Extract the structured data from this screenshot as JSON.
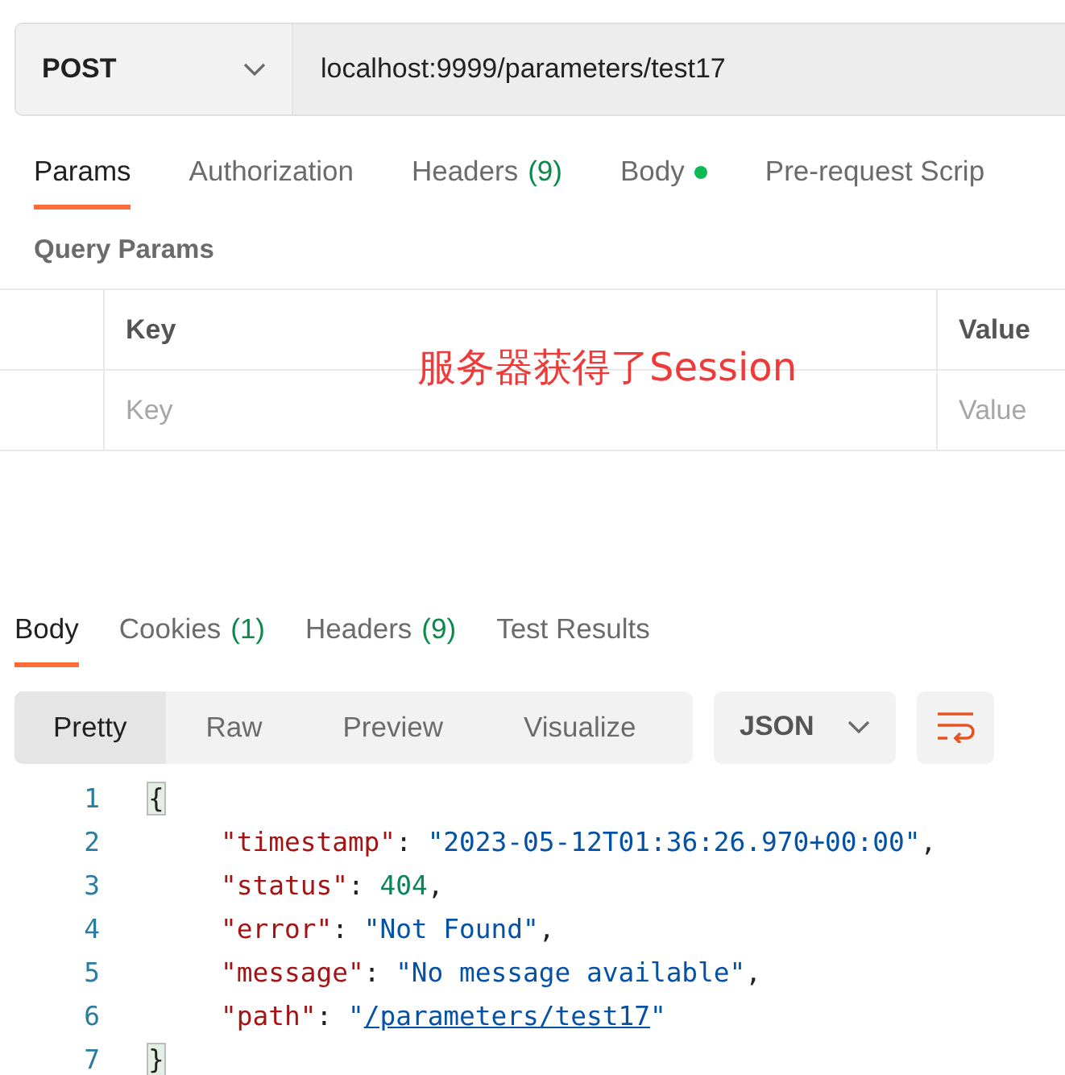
{
  "request": {
    "method": "POST",
    "url": "localhost:9999/parameters/test17"
  },
  "request_tabs": [
    {
      "label": "Params",
      "selected": true
    },
    {
      "label": "Authorization",
      "selected": false
    },
    {
      "label": "Headers",
      "count": "(9)",
      "selected": false
    },
    {
      "label": "Body",
      "dot": true,
      "selected": false
    },
    {
      "label": "Pre-request Scrip",
      "selected": false
    }
  ],
  "query_params": {
    "title": "Query Params",
    "columns": [
      "Key",
      "Value"
    ],
    "placeholders": [
      "Key",
      "Value"
    ]
  },
  "annotation": "服务器获得了Session",
  "response_tabs": [
    {
      "label": "Body",
      "selected": true
    },
    {
      "label": "Cookies",
      "count": "(1)",
      "selected": false
    },
    {
      "label": "Headers",
      "count": "(9)",
      "selected": false
    },
    {
      "label": "Test Results",
      "selected": false
    }
  ],
  "view_modes": [
    {
      "label": "Pretty",
      "selected": true
    },
    {
      "label": "Raw",
      "selected": false
    },
    {
      "label": "Preview",
      "selected": false
    },
    {
      "label": "Visualize",
      "selected": false
    }
  ],
  "format": "JSON",
  "code_lines": [
    {
      "number": "1",
      "tokens": [
        {
          "kind": "brace",
          "text": "{"
        }
      ],
      "children": [
        {
          "number": "2",
          "tokens": [
            {
              "kind": "key",
              "text": "\"timestamp\""
            },
            {
              "kind": "punct",
              "text": ": "
            },
            {
              "kind": "string",
              "text": "\"2023-05-12T01:36:26.970+00:00\""
            },
            {
              "kind": "punct",
              "text": ","
            }
          ]
        },
        {
          "number": "3",
          "tokens": [
            {
              "kind": "key",
              "text": "\"status\""
            },
            {
              "kind": "punct",
              "text": ": "
            },
            {
              "kind": "number",
              "text": "404"
            },
            {
              "kind": "punct",
              "text": ","
            }
          ]
        },
        {
          "number": "4",
          "tokens": [
            {
              "kind": "key",
              "text": "\"error\""
            },
            {
              "kind": "punct",
              "text": ": "
            },
            {
              "kind": "string",
              "text": "\"Not Found\""
            },
            {
              "kind": "punct",
              "text": ","
            }
          ]
        },
        {
          "number": "5",
          "tokens": [
            {
              "kind": "key",
              "text": "\"message\""
            },
            {
              "kind": "punct",
              "text": ": "
            },
            {
              "kind": "string",
              "text": "\"No message available\""
            },
            {
              "kind": "punct",
              "text": ","
            }
          ]
        },
        {
          "number": "6",
          "tokens": [
            {
              "kind": "key",
              "text": "\"path\""
            },
            {
              "kind": "punct",
              "text": ": "
            },
            {
              "kind": "string",
              "text": "\""
            },
            {
              "kind": "link",
              "text": "/parameters/test17"
            },
            {
              "kind": "string",
              "text": "\""
            }
          ]
        }
      ]
    },
    {
      "number": "7",
      "tokens": [
        {
          "kind": "brace",
          "text": "}"
        }
      ]
    }
  ]
}
